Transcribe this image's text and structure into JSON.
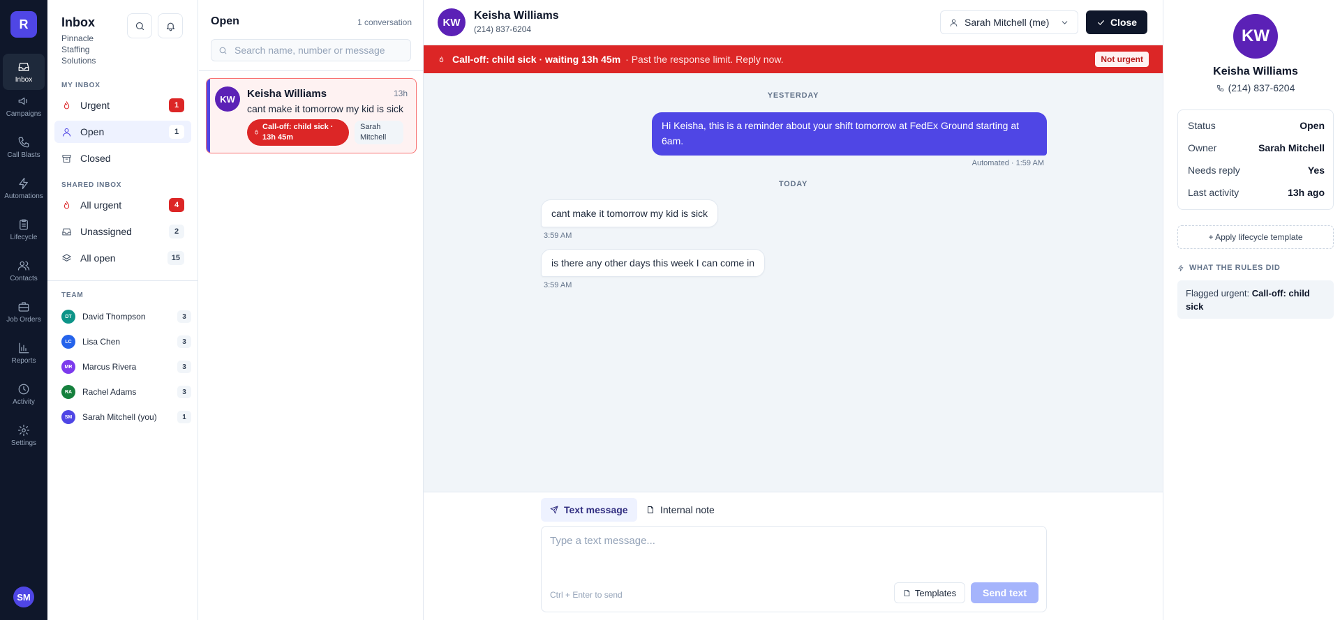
{
  "rail": {
    "logo": "R",
    "items": [
      {
        "label": "Inbox",
        "icon": "inbox-icon"
      },
      {
        "label": "Campaigns",
        "icon": "megaphone-icon"
      },
      {
        "label": "Call Blasts",
        "icon": "phone-icon"
      },
      {
        "label": "Automations",
        "icon": "bolt-icon"
      },
      {
        "label": "Lifecycle",
        "icon": "clipboard-icon"
      },
      {
        "label": "Contacts",
        "icon": "users-icon"
      },
      {
        "label": "Job Orders",
        "icon": "briefcase-icon"
      },
      {
        "label": "Reports",
        "icon": "bar-chart-icon"
      },
      {
        "label": "Activity",
        "icon": "clock-icon"
      },
      {
        "label": "Settings",
        "icon": "gear-icon"
      }
    ],
    "user_initials": "SM"
  },
  "inbox": {
    "title": "Inbox",
    "org": "Pinnacle Staffing Solutions",
    "my_inbox_label": "MY INBOX",
    "my_inbox": [
      {
        "label": "Urgent",
        "count": "1"
      },
      {
        "label": "Open",
        "count": "1"
      },
      {
        "label": "Closed",
        "count": ""
      }
    ],
    "shared_inbox_label": "SHARED INBOX",
    "shared_inbox": [
      {
        "label": "All urgent",
        "count": "4"
      },
      {
        "label": "Unassigned",
        "count": "2"
      },
      {
        "label": "All open",
        "count": "15"
      }
    ],
    "team_label": "TEAM",
    "team": [
      {
        "initials": "DT",
        "name": "David Thompson",
        "count": "3",
        "color": "#0d9488"
      },
      {
        "initials": "LC",
        "name": "Lisa Chen",
        "count": "3",
        "color": "#2563eb"
      },
      {
        "initials": "MR",
        "name": "Marcus Rivera",
        "count": "3",
        "color": "#7c3aed"
      },
      {
        "initials": "RA",
        "name": "Rachel Adams",
        "count": "3",
        "color": "#15803d"
      },
      {
        "initials": "SM",
        "name": "Sarah Mitchell (you)",
        "count": "1",
        "color": "#4f46e5"
      }
    ]
  },
  "list": {
    "title": "Open",
    "count": "1 conversation",
    "search_placeholder": "Search name, number or message",
    "conversations": [
      {
        "initials": "KW",
        "name": "Keisha Williams",
        "time": "13h",
        "snippet": "cant make it tomorrow my kid is sick",
        "tag": "Call-off: child sick · 13h 45m",
        "owner": "Sarah Mitchell"
      }
    ]
  },
  "chat": {
    "initials": "KW",
    "name": "Keisha Williams",
    "phone": "(214) 837-6204",
    "owner": "Sarah Mitchell (me)",
    "close_label": "Close",
    "alert_main": "Call-off: child sick · waiting 13h 45m",
    "alert_sub": "· Past the response limit. Reply now.",
    "not_urgent_label": "Not urgent",
    "day_yesterday": "YESTERDAY",
    "day_today": "TODAY",
    "outgoing": {
      "text": "Hi Keisha, this is a reminder about your shift tomorrow at FedEx Ground starting at 6am.",
      "meta": "Automated · 1:59 AM"
    },
    "incoming": [
      {
        "text": "cant make it tomorrow my kid is sick",
        "time": "3:59 AM"
      },
      {
        "text": "is there any other days this week I can come in",
        "time": "3:59 AM"
      }
    ],
    "composer": {
      "tab_text": "Text message",
      "tab_note": "Internal note",
      "placeholder": "Type a text message...",
      "hint": "Ctrl + Enter to send",
      "templates_label": "Templates",
      "send_label": "Send text"
    }
  },
  "contact": {
    "initials": "KW",
    "name": "Keisha Williams",
    "phone": "(214) 837-6204",
    "details": [
      {
        "key": "Status",
        "value": "Open"
      },
      {
        "key": "Owner",
        "value": "Sarah Mitchell"
      },
      {
        "key": "Needs reply",
        "value": "Yes"
      },
      {
        "key": "Last activity",
        "value": "13h ago"
      }
    ],
    "lifecycle_label": "+ Apply lifecycle template",
    "rules_label": "WHAT THE RULES DID",
    "rule_prefix": "Flagged urgent:",
    "rule_value": "Call-off: child sick"
  },
  "colors": {
    "accent": "#4f46e5",
    "urgent": "#dc2626",
    "rail": "#0f172a"
  }
}
